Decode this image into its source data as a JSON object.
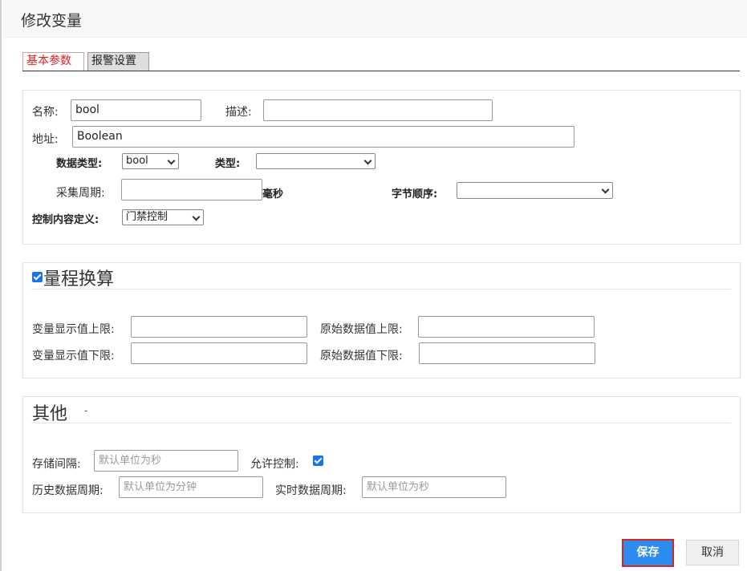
{
  "dialog": {
    "title": "修改变量"
  },
  "tabs": [
    {
      "label": "基本参数",
      "active": true
    },
    {
      "label": "报警设置",
      "active": false
    }
  ],
  "basic": {
    "name_label": "名称:",
    "name_value": "bool",
    "desc_label": "描述:",
    "desc_value": "",
    "address_label": "地址:",
    "address_value": "Boolean",
    "datatype_label": "数据类型:",
    "datatype_value": "bool",
    "type_label": "类型:",
    "type_value": "",
    "period_label": "采集周期:",
    "period_value": "",
    "period_unit": "毫秒",
    "byteorder_label": "字节顺序:",
    "byteorder_value": "",
    "control_label": "控制内容定义:",
    "control_value": "门禁控制"
  },
  "range": {
    "title": "量程换算",
    "checked": true,
    "display_upper_label": "变量显示值上限:",
    "raw_upper_label": "原始数据值上限:",
    "display_lower_label": "变量显示值下限:",
    "raw_lower_label": "原始数据值下限:"
  },
  "other": {
    "title": "其他",
    "dash": "-",
    "storage_label": "存储间隔:",
    "storage_placeholder": "默认单位为秒",
    "allow_control_label": "允许控制:",
    "allow_control_checked": true,
    "history_label": "历史数据周期:",
    "history_placeholder": "默认单位为分钟",
    "realtime_label": "实时数据周期:",
    "realtime_placeholder": "默认单位为秒"
  },
  "footer": {
    "save_label": "保存",
    "cancel_label": "取消"
  },
  "colors": {
    "primary": "#2d8cf0",
    "active_tab_text": "#dd2222",
    "save_border": "#d9261c"
  }
}
